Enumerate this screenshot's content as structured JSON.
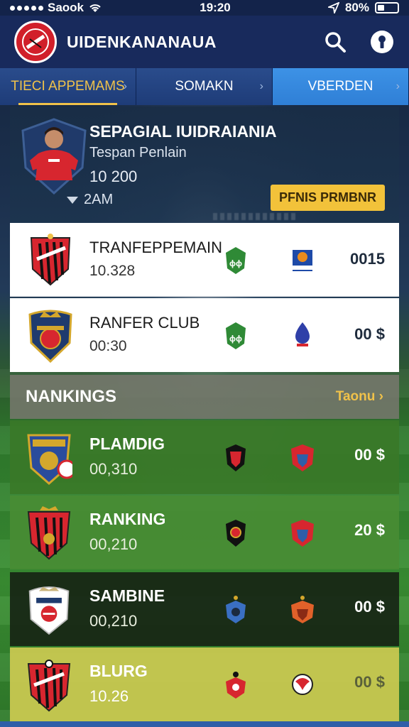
{
  "status_bar": {
    "carrier": "Saook",
    "time": "19:20",
    "battery": "80%"
  },
  "header": {
    "title": "UIDENKANANAUA"
  },
  "tabs": [
    {
      "label": "TIECI APPEMAMS"
    },
    {
      "label": "SOMAKN"
    },
    {
      "label": "VBERDEN"
    }
  ],
  "featured": {
    "name": "SEPAGIAL IUIDRAIANIA",
    "role": "Tespan Penlain",
    "value": "10 200",
    "sub": "2AM",
    "badge": "PFNIS PRMBNR"
  },
  "transfers": [
    {
      "title": "TRANFEPPEMAIN",
      "number": "10.328",
      "price": "0015"
    },
    {
      "title": "RANFER CLUB",
      "number": "00:30",
      "price": "00 $"
    }
  ],
  "rankings": {
    "label": "NANKINGS",
    "more": "Taonu",
    "items": [
      {
        "title": "PLAMDIG",
        "number": "00,310",
        "price": "00 $"
      },
      {
        "title": "RANKING",
        "number": "00,210",
        "price": "20 $"
      },
      {
        "title": "SAMBINE",
        "number": "00,210",
        "price": "00 $"
      },
      {
        "title": "BLURG",
        "number": "10.26",
        "price": "00 $"
      }
    ]
  },
  "colors": {
    "accent": "#f0c24a",
    "header_bg": "#182a5c",
    "active_tab": "#3d92e6",
    "crest_red": "#d11f2a"
  },
  "icons": [
    "search-icon",
    "keyhole-icon",
    "club-logo-icon",
    "chevron-right-icon"
  ]
}
